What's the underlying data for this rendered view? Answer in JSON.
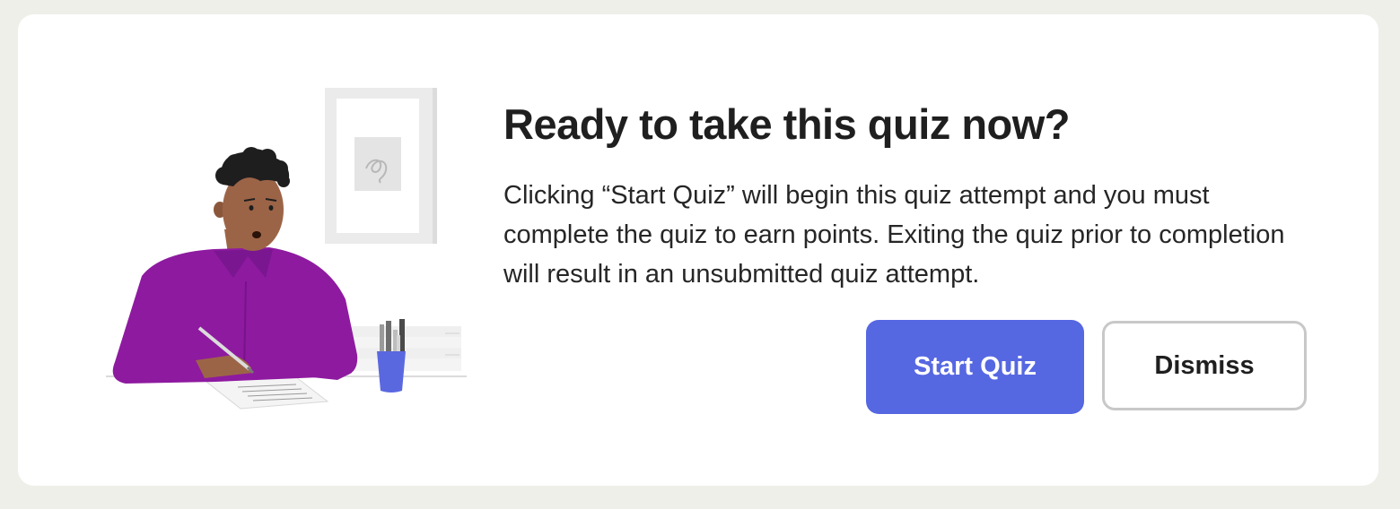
{
  "dialog": {
    "title": "Ready to take this quiz now?",
    "description": "Clicking “Start Quiz” will begin this quiz attempt and you must complete the quiz to earn points. Exiting the quiz prior to completion will result in an unsubmitted quiz attempt.",
    "start_label": "Start Quiz",
    "dismiss_label": "Dismiss",
    "illustration": "person-writing-at-desk-illustration"
  },
  "colors": {
    "page_background": "#efefea",
    "card_background": "#ffffff",
    "primary_button": "#5667e2",
    "secondary_border": "#c8c8c8",
    "shirt": "#8e1aa0",
    "pen_cup": "#5a68e0"
  }
}
